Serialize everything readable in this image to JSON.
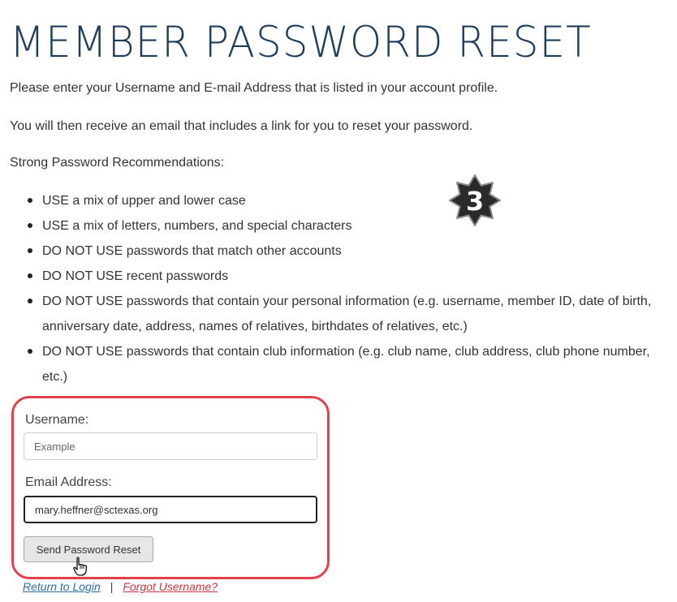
{
  "page": {
    "title": "MEMBER PASSWORD RESET",
    "intro": "Please enter your Username and E-mail Address that is listed in your account profile.",
    "info": "You will then receive an email that includes a link for you to reset your password.",
    "recommendations_heading": "Strong Password Recommendations:",
    "recommendations": [
      "USE a mix of upper and lower case",
      "USE a mix of letters, numbers, and special characters",
      "DO NOT USE passwords that match other accounts",
      "DO NOT USE recent passwords",
      "DO NOT USE passwords that contain your personal information (e.g. username, member ID, date of birth, anniversary date, address, names of relatives, birthdates of relatives, etc.)",
      "DO NOT USE passwords that contain club information (e.g. club name, club address, club phone number, etc.)"
    ]
  },
  "step_badge": {
    "number": "3",
    "color": "#2a2a2a"
  },
  "form": {
    "highlight_color": "#e2414c",
    "username_label": "Username:",
    "username_placeholder": "Example",
    "email_label": "Email Address:",
    "email_value": "mary.heffner@sctexas.org",
    "submit_label": "Send Password Reset"
  },
  "links": {
    "return_login": "Return to Login",
    "separator": "|",
    "forgot_username": "Forgot Username?"
  }
}
